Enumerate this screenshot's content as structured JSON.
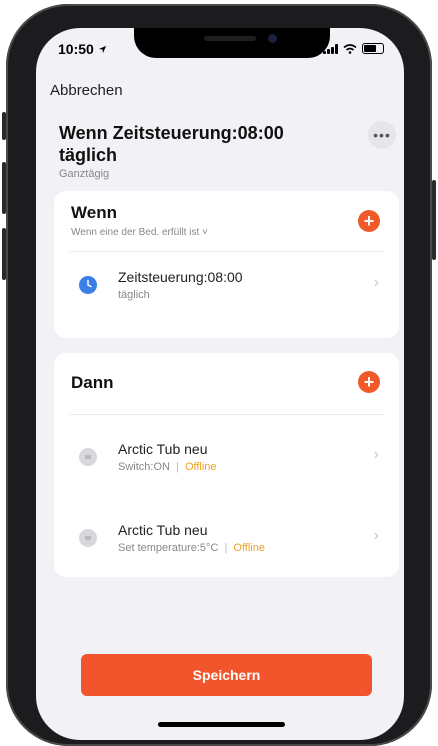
{
  "status_bar": {
    "time": "10:50"
  },
  "nav": {
    "cancel_label": "Abbrechen"
  },
  "header": {
    "title": "Wenn Zeitsteuerung:08:00 täglich",
    "subtitle": "Ganztägig",
    "more_glyph": "•••"
  },
  "conditions": {
    "title": "Wenn",
    "subtitle": "Wenn eine der Bed. erfüllt ist ˅",
    "add_glyph": "+",
    "items": [
      {
        "title": "Zeitsteuerung:08:00",
        "subtitle": "täglich",
        "icon": "clock-icon"
      }
    ]
  },
  "actions": {
    "title": "Dann",
    "add_glyph": "+",
    "items": [
      {
        "title": "Arctic Tub neu",
        "detail": "Switch:ON",
        "separator": "|",
        "status": "Offline",
        "icon": "device-icon"
      },
      {
        "title": "Arctic Tub neu",
        "detail": "Set temperature:5°C",
        "separator": "|",
        "status": "Offline",
        "icon": "device-icon"
      }
    ]
  },
  "footer": {
    "save_label": "Speichern"
  },
  "colors": {
    "accent": "#f2552c",
    "offline": "#f0a020",
    "clock": "#3a7ee8"
  }
}
